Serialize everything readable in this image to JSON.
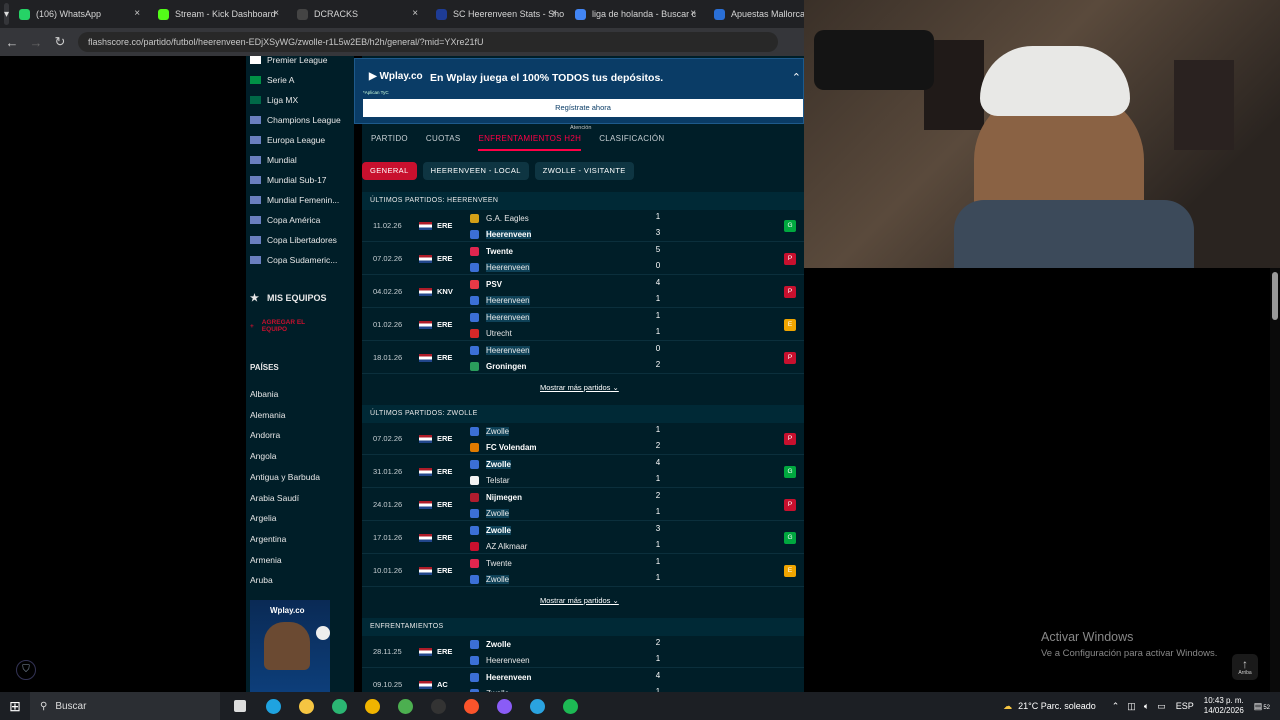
{
  "browser": {
    "tabs": [
      {
        "label": "(106) WhatsApp",
        "color": "#25d366"
      },
      {
        "label": "Stream - Kick Dashboard",
        "color": "#53fc18"
      },
      {
        "label": "DCRACKS",
        "color": "#444444"
      },
      {
        "label": "SC Heerenveen Stats - Sho",
        "color": "#1e3c96"
      },
      {
        "label": "liga de holanda - Buscar c",
        "color": "#4285f4"
      },
      {
        "label": "Apuestas Mallorca",
        "color": "#2a6fd6"
      }
    ],
    "url": "flashscore.co/partido/futbol/heerenveen-EDjXSyWG/zwolle-r1L5w2EB/h2h/general/?mid=YXre21fU"
  },
  "sidebar": {
    "leagues": [
      {
        "label": "Premier League",
        "flag": "#ffffff"
      },
      {
        "label": "Serie A",
        "flag": "#009246"
      },
      {
        "label": "Liga MX",
        "flag": "#006847"
      },
      {
        "label": "Champions League",
        "flag": "#6a7fbf"
      },
      {
        "label": "Europa League",
        "flag": "#6a7fbf"
      },
      {
        "label": "Mundial",
        "flag": "#6a7fbf"
      },
      {
        "label": "Mundial Sub-17",
        "flag": "#6a7fbf"
      },
      {
        "label": "Mundial Femenin...",
        "flag": "#6a7fbf"
      },
      {
        "label": "Copa América",
        "flag": "#6a7fbf"
      },
      {
        "label": "Copa Libertadores",
        "flag": "#6a7fbf"
      },
      {
        "label": "Copa Sudameric...",
        "flag": "#6a7fbf"
      }
    ],
    "my_teams": "MIS EQUIPOS",
    "add_team": "AGREGAR EL EQUIPO",
    "countries_title": "PAÍSES",
    "countries": [
      "Albania",
      "Alemania",
      "Andorra",
      "Angola",
      "Antigua y Barbuda",
      "Arabia Saudí",
      "Argelia",
      "Argentina",
      "Armenia",
      "Aruba"
    ]
  },
  "ad": {
    "logo": "Wplay.co",
    "text": "En Wplay juega el 100% TODOS tus depósitos.",
    "small": "*Aplican TyC",
    "button": "Regístrate ahora"
  },
  "match_tabs": [
    "PARTIDO",
    "CUOTAS",
    "ENFRENTAMIENTOS H2H",
    "CLASIFICACIÓN"
  ],
  "tab_note": "Atención",
  "filter_pills": [
    "GENERAL",
    "HEERENVEEN - LOCAL",
    "ZWOLLE - VISITANTE"
  ],
  "sections": [
    {
      "title": "ÚLTIMOS PARTIDOS: HEERENVEEN",
      "more": "Mostrar más partidos",
      "rows": [
        {
          "date": "11.02.26",
          "comp": "ERE",
          "home": "G.A. Eagles",
          "away": "Heerenveen",
          "hs": "1",
          "as": "3",
          "res": "G",
          "res_color": "#00a83f",
          "bold": "away",
          "hl": "away",
          "hc": "#d4a017",
          "ac": "#3b6fd6"
        },
        {
          "date": "07.02.26",
          "comp": "ERE",
          "home": "Twente",
          "away": "Heerenveen",
          "hs": "5",
          "as": "0",
          "res": "P",
          "res_color": "#c8102e",
          "bold": "home",
          "hl": "away",
          "hc": "#e0264f",
          "ac": "#3b6fd6"
        },
        {
          "date": "04.02.26",
          "comp": "KNV",
          "home": "PSV",
          "away": "Heerenveen",
          "hs": "4",
          "as": "1",
          "res": "P",
          "res_color": "#c8102e",
          "bold": "home",
          "hl": "away",
          "hc": "#e63946",
          "ac": "#3b6fd6"
        },
        {
          "date": "01.02.26",
          "comp": "ERE",
          "home": "Heerenveen",
          "away": "Utrecht",
          "hs": "1",
          "as": "1",
          "res": "E",
          "res_color": "#f0a500",
          "bold": "",
          "hl": "home",
          "hc": "#3b6fd6",
          "ac": "#d62828"
        },
        {
          "date": "18.01.26",
          "comp": "ERE",
          "home": "Heerenveen",
          "away": "Groningen",
          "hs": "0",
          "as": "2",
          "res": "P",
          "res_color": "#c8102e",
          "bold": "away",
          "hl": "home",
          "hc": "#3b6fd6",
          "ac": "#2a9d5c"
        }
      ]
    },
    {
      "title": "ÚLTIMOS PARTIDOS: ZWOLLE",
      "more": "Mostrar más partidos",
      "rows": [
        {
          "date": "07.02.26",
          "comp": "ERE",
          "home": "Zwolle",
          "away": "FC Volendam",
          "hs": "1",
          "as": "2",
          "res": "P",
          "res_color": "#c8102e",
          "bold": "away",
          "hl": "home",
          "hc": "#3b6fd6",
          "ac": "#e07b00"
        },
        {
          "date": "31.01.26",
          "comp": "ERE",
          "home": "Zwolle",
          "away": "Telstar",
          "hs": "4",
          "as": "1",
          "res": "G",
          "res_color": "#00a83f",
          "bold": "home",
          "hl": "home",
          "hc": "#3b6fd6",
          "ac": "#f2f2f2"
        },
        {
          "date": "24.01.26",
          "comp": "ERE",
          "home": "Nijmegen",
          "away": "Zwolle",
          "hs": "2",
          "as": "1",
          "res": "P",
          "res_color": "#c8102e",
          "bold": "home",
          "hl": "away",
          "hc": "#b01c2e",
          "ac": "#3b6fd6"
        },
        {
          "date": "17.01.26",
          "comp": "ERE",
          "home": "Zwolle",
          "away": "AZ Alkmaar",
          "hs": "3",
          "as": "1",
          "res": "G",
          "res_color": "#00a83f",
          "bold": "home",
          "hl": "home",
          "hc": "#3b6fd6",
          "ac": "#c8102e"
        },
        {
          "date": "10.01.26",
          "comp": "ERE",
          "home": "Twente",
          "away": "Zwolle",
          "hs": "1",
          "as": "1",
          "res": "E",
          "res_color": "#f0a500",
          "bold": "",
          "hl": "away",
          "hc": "#e0264f",
          "ac": "#3b6fd6"
        }
      ]
    },
    {
      "title": "ENFRENTAMIENTOS",
      "more": "",
      "rows": [
        {
          "date": "28.11.25",
          "comp": "ERE",
          "home": "Zwolle",
          "away": "Heerenveen",
          "hs": "2",
          "as": "1",
          "res": "",
          "res_color": "",
          "bold": "home",
          "hl": "",
          "hc": "#3b6fd6",
          "ac": "#3b6fd6"
        },
        {
          "date": "09.10.25",
          "comp": "AC",
          "home": "Heerenveen",
          "away": "Zwolle",
          "hs": "4",
          "as": "1",
          "res": "",
          "res_color": "",
          "bold": "home",
          "hl": "",
          "hc": "#3b6fd6",
          "ac": "#3b6fd6"
        }
      ]
    }
  ],
  "windows": {
    "activate_title": "Activar Windows",
    "activate_sub": "Ve a Configuración para activar Windows.",
    "arriba": "Arriba"
  },
  "taskbar": {
    "search": "Buscar",
    "weather": "21°C  Parc. soleado",
    "lang": "ESP",
    "time": "10:43 p. m.",
    "date": "14/02/2026",
    "notif": "52",
    "apps": [
      {
        "name": "task-view-icon",
        "color": "#dddddd"
      },
      {
        "name": "edge-icon",
        "color": "#1fa3e0"
      },
      {
        "name": "file-explorer-icon",
        "color": "#f5c542"
      },
      {
        "name": "edge-beta-icon",
        "color": "#2bb673"
      },
      {
        "name": "chrome-canary-icon",
        "color": "#f0b400"
      },
      {
        "name": "chrome-icon",
        "color": "#4caf50"
      },
      {
        "name": "obs-icon",
        "color": "#333333"
      },
      {
        "name": "brave-icon",
        "color": "#fb542b"
      },
      {
        "name": "discord-icon",
        "color": "#8a5cf6"
      },
      {
        "name": "telegram-icon",
        "color": "#2aa3e0"
      },
      {
        "name": "spotify-icon",
        "color": "#1db954"
      }
    ]
  }
}
